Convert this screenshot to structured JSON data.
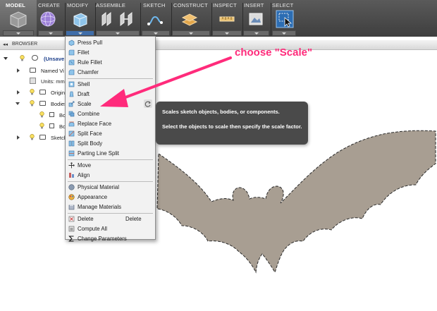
{
  "toolbar": {
    "tabs": [
      "MODEL",
      "CREATE",
      "MODIFY",
      "ASSEMBLE",
      "SKETCH",
      "CONSTRUCT",
      "INSPECT",
      "INSERT",
      "SELECT"
    ]
  },
  "browser": {
    "title": "BROWSER",
    "collapse_glyph": "◂◂",
    "items": [
      {
        "label": "(Unsave"
      },
      {
        "label": "Named Vi"
      },
      {
        "label": "Units: mm"
      },
      {
        "label": "Origin"
      },
      {
        "label": "Bodies"
      },
      {
        "label": "Bo"
      },
      {
        "label": "Bo"
      },
      {
        "label": "Sketche"
      }
    ]
  },
  "menu": {
    "items": [
      {
        "label": "Press Pull",
        "shortcut": ""
      },
      {
        "label": "Fillet",
        "shortcut": ""
      },
      {
        "label": "Rule Fillet",
        "shortcut": ""
      },
      {
        "label": "Chamfer",
        "shortcut": ""
      },
      {
        "label": "Shell",
        "shortcut": ""
      },
      {
        "label": "Draft",
        "shortcut": ""
      },
      {
        "label": "Scale",
        "shortcut": ""
      },
      {
        "label": "Combine",
        "shortcut": ""
      },
      {
        "label": "Replace Face",
        "shortcut": ""
      },
      {
        "label": "Split Face",
        "shortcut": ""
      },
      {
        "label": "Split Body",
        "shortcut": ""
      },
      {
        "label": "Parting Line Split",
        "shortcut": ""
      },
      {
        "label": "Move",
        "shortcut": ""
      },
      {
        "label": "Align",
        "shortcut": ""
      },
      {
        "label": "Physical Material",
        "shortcut": ""
      },
      {
        "label": "Appearance",
        "shortcut": ""
      },
      {
        "label": "Manage Materials",
        "shortcut": ""
      },
      {
        "label": "Delete",
        "shortcut": "Delete"
      },
      {
        "label": "Compute All",
        "shortcut": ""
      },
      {
        "label": "Change Parameters",
        "shortcut": ""
      }
    ]
  },
  "tooltip": {
    "title": "Scales sketch objects, bodies, or components.",
    "body": "Select the objects to scale then specify the scale factor."
  },
  "annotation": {
    "text": "choose \"Scale\"",
    "color": "#ff2b7b"
  },
  "colors": {
    "toolbar_bg": "#4a4a4a",
    "shape_fill": "#a89e92",
    "accent_pink": "#ff2b7b",
    "tooltip_bg": "#4a4a4a"
  }
}
